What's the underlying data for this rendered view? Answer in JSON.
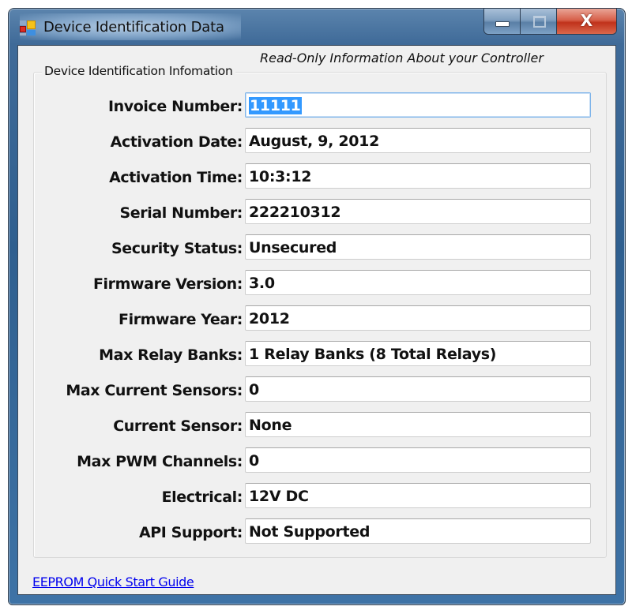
{
  "window": {
    "title": "Device Identification Data",
    "app_icon": "winforms-app-icon",
    "controls": {
      "minimize_icon": "minimize-icon",
      "maximize_icon": "maximize-icon",
      "close_icon": "close-icon",
      "close_glyph": "X"
    }
  },
  "header": {
    "subtitle": "Read-Only Information About your Controller"
  },
  "group": {
    "legend": "Device Identification Infomation",
    "fields": [
      {
        "label": "Invoice Number:",
        "value": "11111",
        "selected": true
      },
      {
        "label": "Activation Date:",
        "value": "August, 9, 2012"
      },
      {
        "label": "Activation Time:",
        "value": "10:3:12"
      },
      {
        "label": "Serial Number:",
        "value": "222210312"
      },
      {
        "label": "Security Status:",
        "value": "Unsecured"
      },
      {
        "label": "Firmware Version:",
        "value": "3.0"
      },
      {
        "label": "Firmware Year:",
        "value": "2012"
      },
      {
        "label": "Max Relay Banks:",
        "value": "1 Relay Banks (8 Total Relays)"
      },
      {
        "label": "Max Current Sensors:",
        "value": "0"
      },
      {
        "label": "Current Sensor:",
        "value": "None"
      },
      {
        "label": "Max PWM Channels:",
        "value": "0"
      },
      {
        "label": "Electrical:",
        "value": "12V DC"
      },
      {
        "label": "API Support:",
        "value": "Not Supported"
      }
    ]
  },
  "footer": {
    "link_text": "EEPROM Quick Start Guide"
  },
  "colors": {
    "selection": "#3399ff",
    "link": "#0000ee",
    "title_bar": "#2f5f8f",
    "close_button": "#c0321b"
  }
}
